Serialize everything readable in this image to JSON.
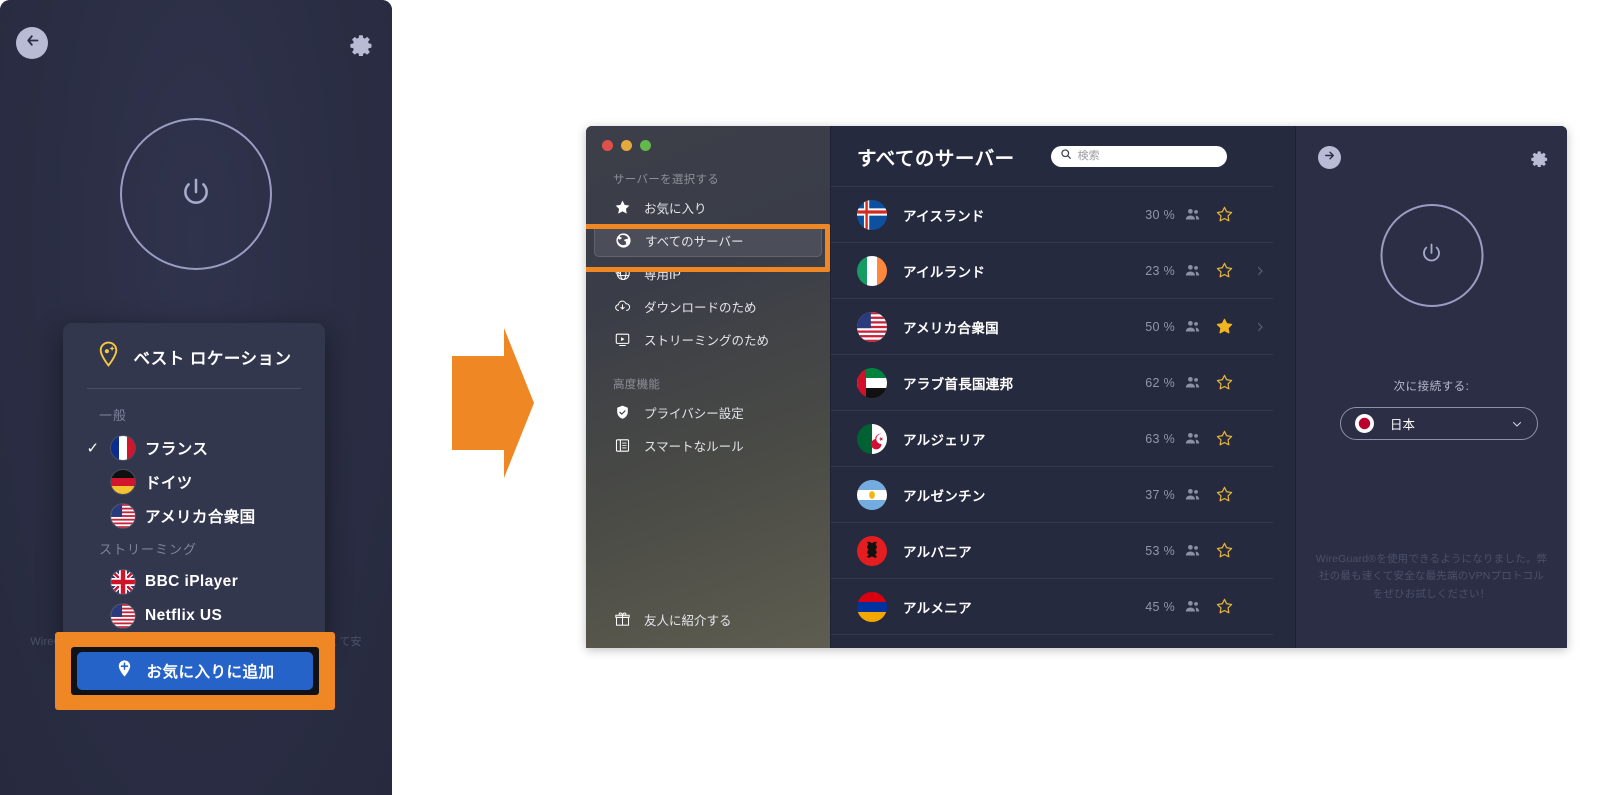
{
  "left_window": {
    "back_icon": "arrow-left-icon",
    "gear_icon": "gear-icon",
    "power_icon": "power-icon",
    "footnote": "WireGuard®を使用できるようになりました。弊社の最も速くて安全な最先端のVPNプロトコルをぜひお試しください！",
    "popup": {
      "title": "ベスト ロケーション",
      "title_icon": "location-pin-sparkle-icon",
      "groups": [
        {
          "label": "一般",
          "items": [
            {
              "name": "フランス",
              "flag": "fr",
              "checked": true
            },
            {
              "name": "ドイツ",
              "flag": "de",
              "checked": false
            },
            {
              "name": "アメリカ合衆国",
              "flag": "us",
              "checked": false
            }
          ]
        },
        {
          "label": "ストリーミング",
          "items": [
            {
              "name": "BBC iPlayer",
              "flag": "gb",
              "checked": false
            },
            {
              "name": "Netflix US",
              "flag": "us",
              "checked": false
            }
          ]
        }
      ]
    },
    "favorite_button": {
      "label": "お気に入りに追加",
      "icon": "pin-plus-icon",
      "color": "#2563c9",
      "highlight_color": "#ee8724"
    }
  },
  "arrow": {
    "name": "step-arrow",
    "color": "#ee8724"
  },
  "app_window": {
    "traffic_lights": {
      "close": "#e0504a",
      "minimize": "#e6a93c",
      "zoom": "#62b84b"
    },
    "sidebar": {
      "group_one_label": "サーバーを選択する",
      "group_two_label": "高度機能",
      "highlight_color": "#ee8724",
      "items": [
        {
          "label": "お気に入り",
          "icon": "star-icon",
          "selected": false
        },
        {
          "label": "すべてのサーバー",
          "icon": "globe-icon",
          "selected": true
        },
        {
          "label": "専用IP",
          "icon": "dedicated-ip-icon",
          "selected": false
        },
        {
          "label": "ダウンロードのため",
          "icon": "download-cloud-icon",
          "selected": false
        },
        {
          "label": "ストリーミングのため",
          "icon": "play-screen-icon",
          "selected": false
        }
      ],
      "advanced_items": [
        {
          "label": "プライバシー設定",
          "icon": "shield-check-icon",
          "selected": false
        },
        {
          "label": "スマートなルール",
          "icon": "rules-icon",
          "selected": false
        }
      ],
      "referral": {
        "label": "友人に紹介する",
        "icon": "gift-icon"
      }
    },
    "list": {
      "title": "すべてのサーバー",
      "search": {
        "placeholder": "検索",
        "value": "",
        "icon": "search-icon"
      },
      "rows": [
        {
          "country": "アイスランド",
          "flag": "is",
          "load": "30 %",
          "favorite": false,
          "chevron": false
        },
        {
          "country": "アイルランド",
          "flag": "ie",
          "load": "23 %",
          "favorite": false,
          "chevron": true
        },
        {
          "country": "アメリカ合衆国",
          "flag": "us",
          "load": "50 %",
          "favorite": true,
          "chevron": true
        },
        {
          "country": "アラブ首長国連邦",
          "flag": "ae",
          "load": "62 %",
          "favorite": false,
          "chevron": false
        },
        {
          "country": "アルジェリア",
          "flag": "dz",
          "load": "63 %",
          "favorite": false,
          "chevron": false
        },
        {
          "country": "アルゼンチン",
          "flag": "ar",
          "load": "37 %",
          "favorite": false,
          "chevron": false
        },
        {
          "country": "アルバニア",
          "flag": "al",
          "load": "53 %",
          "favorite": false,
          "chevron": false
        },
        {
          "country": "アルメニア",
          "flag": "am",
          "load": "45 %",
          "favorite": false,
          "chevron": false
        }
      ]
    },
    "right_panel": {
      "expand_icon": "arrow-right-circle-icon",
      "gear_icon": "gear-icon",
      "power_icon": "power-icon",
      "next_connect_label": "次に接続する:",
      "selected_country": {
        "name": "日本",
        "flag": "jp"
      },
      "chevron_icon": "chevron-down-icon",
      "note": "WireGuard®を使用できるようになりました。弊社の最も速くて安全な最先端のVPNプロトコルをぜひお試しください！"
    }
  }
}
